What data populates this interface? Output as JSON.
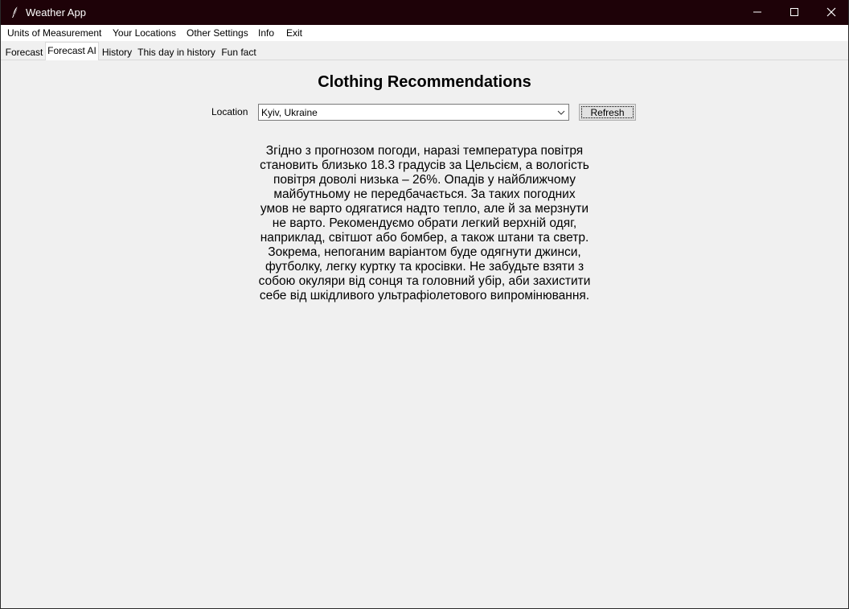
{
  "window": {
    "title": "Weather App",
    "icon": "feather-icon"
  },
  "titlebar_buttons": {
    "minimize": "minimize-icon",
    "maximize": "maximize-icon",
    "close": "close-icon"
  },
  "menu": {
    "items": [
      "Units of Measurement",
      "Your Locations",
      "Other Settings",
      "Info",
      "Exit"
    ]
  },
  "tabs": {
    "items": [
      "Forecast",
      "Forecast AI",
      "History",
      "This day in history",
      "Fun fact"
    ],
    "active": "Forecast AI"
  },
  "main": {
    "heading": "Clothing Recommendations",
    "location_label": "Location",
    "location_value": "Kyiv, Ukraine",
    "refresh_label": "Refresh",
    "recommendation": "Згідно з прогнозом погоди, наразі температура повітря становить близько 18.3 градусів за Цельсієм, а вологість повітря доволі низька – 26%. Опадів у найближчому майбутньому не передбачається. За таких погодних умов не варто одягатися надто тепло, але й за мерзнути не варто. Рекомендуємо обрати легкий верхній одяг, наприклад, світшот або бомбер, а також штани та светр. Зокрема, непоганим варіантом буде одягнути джинси, футболку, легку куртку та кросівки. Не забудьте взяти з собою окуляри від сонця та головний убір, аби захистити себе від шкідливого ультрафіолетового випромінювання."
  },
  "colors": {
    "titlebar": "#1e0208",
    "background": "#f0f0f0",
    "menubar": "#ffffff"
  }
}
